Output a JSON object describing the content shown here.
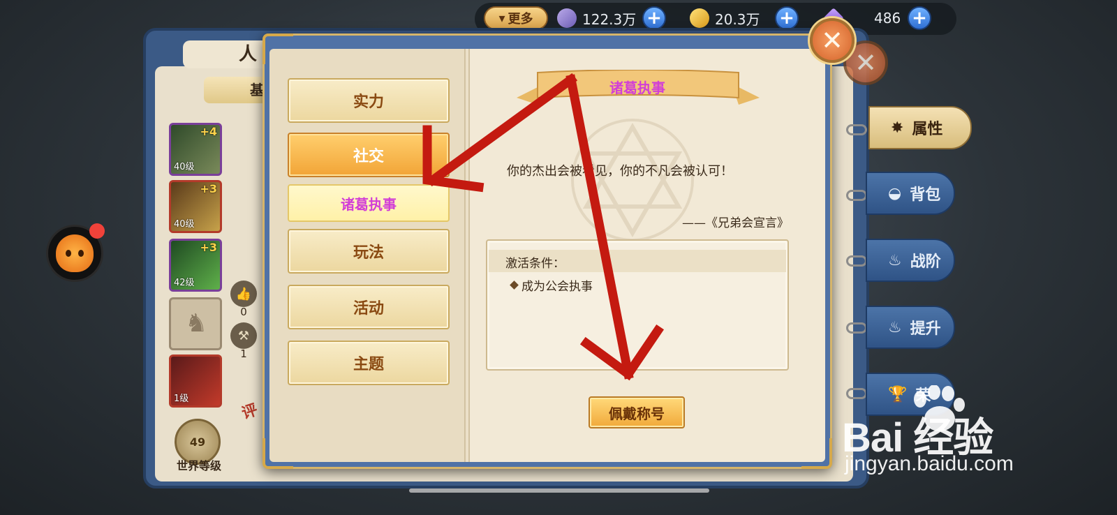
{
  "topbar": {
    "more_label": "更多",
    "currencies": [
      {
        "icon": "feather-icon",
        "value": "122.3万"
      },
      {
        "icon": "gold-leaf-icon",
        "value": "20.3万"
      },
      {
        "icon": "crystal-icon",
        "value": "486"
      }
    ],
    "plus_label": "+"
  },
  "back_panel": {
    "title": "人",
    "base_label": "基",
    "items": [
      {
        "level": "40级",
        "plus": "+4",
        "color": "#7a3f9a"
      },
      {
        "level": "40级",
        "plus": "+3",
        "color": "#b33a2a"
      },
      {
        "level": "42级",
        "plus": "+3",
        "color": "#7a3f9a"
      },
      {
        "level": "",
        "plus": "",
        "color": "#9a8a72"
      },
      {
        "level": "1级",
        "plus": "",
        "color": "#b33a2a"
      }
    ],
    "like_count": "0",
    "hammer_count": "1",
    "world_level": "49",
    "world_level_label": "世界等级",
    "rate_label": "评"
  },
  "side_tabs": [
    {
      "label": "属性",
      "icon": "star-icon",
      "active": true
    },
    {
      "label": "背包",
      "icon": "bag-icon",
      "active": false
    },
    {
      "label": "战阶",
      "icon": "flame-icon",
      "active": false
    },
    {
      "label": "提升",
      "icon": "flame-icon",
      "active": false
    },
    {
      "label": "荣",
      "icon": "trophy-icon",
      "active": false
    }
  ],
  "dialog": {
    "categories": [
      {
        "label": "实力",
        "active": false
      },
      {
        "label": "社交",
        "active": true
      },
      {
        "label": "玩法",
        "active": false
      },
      {
        "label": "活动",
        "active": false
      },
      {
        "label": "主题",
        "active": false
      }
    ],
    "selected_sub": "诸葛执事",
    "title_ribbon": "诸葛执事",
    "quote": "你的杰出会被看见，你的不凡会被认可！",
    "source": "——《兄弟会宣言》",
    "condition_title": "激活条件：",
    "condition_item": "成为公会执事",
    "wear_button": "佩戴称号",
    "close_label": "✕"
  },
  "watermark": {
    "logo": "Bai  经验",
    "url": "jingyan.baidu.com"
  },
  "colors": {
    "arrow": "#c41a10",
    "accent_pink": "#d23fd6",
    "button_gold": "#f1a93a"
  }
}
